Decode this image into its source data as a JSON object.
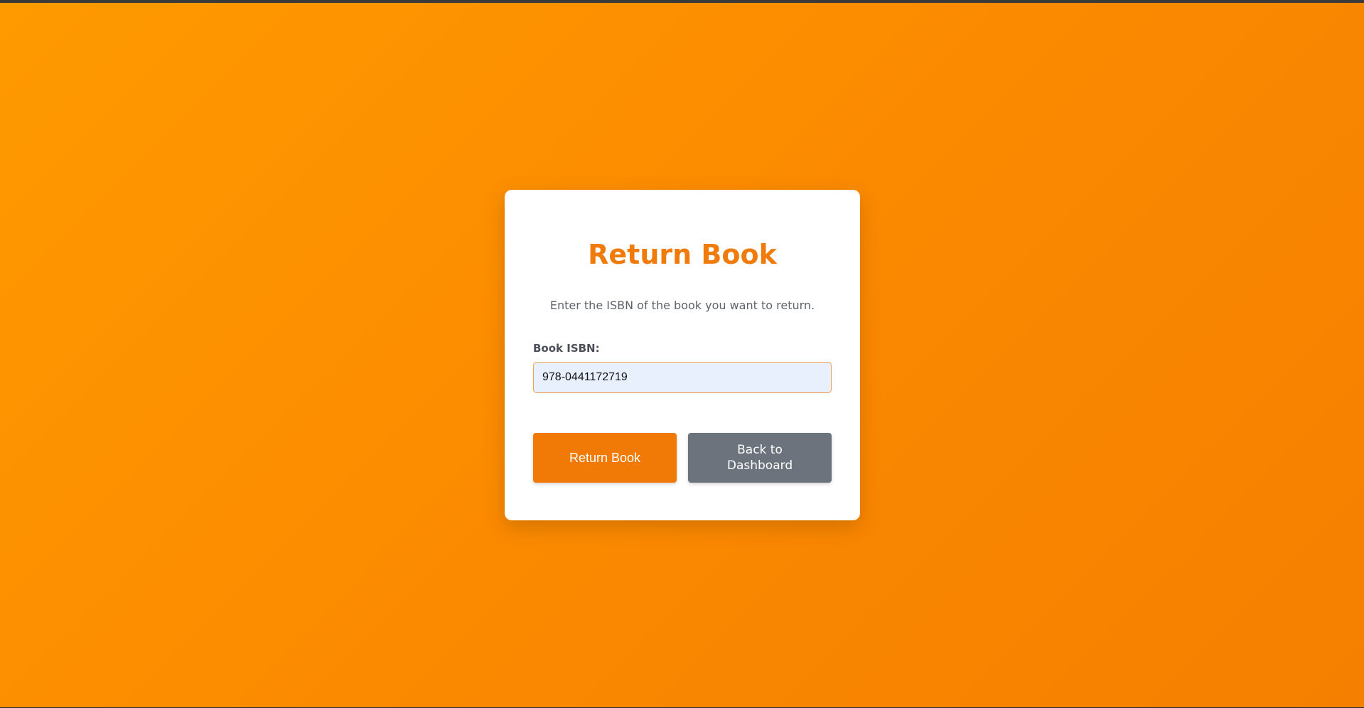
{
  "page": {
    "title": "Return Book",
    "subtitle": "Enter the ISBN of the book you want to return."
  },
  "form": {
    "isbn_label": "Book ISBN:",
    "isbn_value": "978-0441172719"
  },
  "buttons": {
    "return_label": "Return Book",
    "back_label": "Back to Dashboard"
  },
  "colors": {
    "accent": "#f07a05",
    "background_start": "#ff9a00",
    "background_end": "#f57f00",
    "secondary_button": "#6c737d",
    "input_background": "#e8f0fe"
  }
}
